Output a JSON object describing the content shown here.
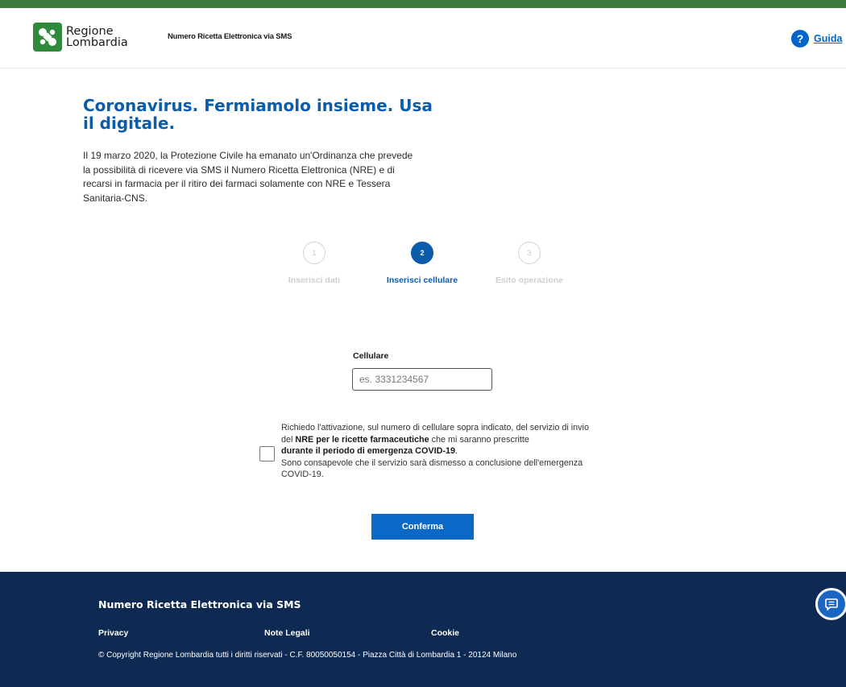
{
  "header": {
    "logo_line1": "Regione",
    "logo_line2": "Lombardia",
    "app_title": "Numero Ricetta Elettronica via SMS",
    "help_icon": "question-icon",
    "help_label": "Guida"
  },
  "main": {
    "heading": "Coronavirus. Fermiamolo insieme. Usa il digitale.",
    "intro": "Il 19 marzo 2020, la Protezione Civile ha emanato un'Ordinanza che prevede la possibilità di ricevere via SMS il Numero Ricetta Elettronica (NRE) e di recarsi in farmacia per il ritiro dei farmaci solamente con NRE e Tessera Sanitaria-CNS."
  },
  "stepper": {
    "steps": [
      {
        "number": "1",
        "label": "Inserisci dati",
        "active": false
      },
      {
        "number": "2",
        "label": "Inserisci cellulare",
        "active": true
      },
      {
        "number": "3",
        "label": "Esito operazione",
        "active": false
      }
    ]
  },
  "form": {
    "phone_label": "Cellulare",
    "phone_placeholder": "es. 3331234567",
    "phone_value": "",
    "consent_checked": false,
    "consent_part1": "Richiedo l'attivazione, sul numero di cellulare sopra indicato, del servizio di invio del ",
    "consent_bold1": "NRE per le ricette farmaceutiche",
    "consent_part2": " che mi saranno prescritte ",
    "consent_bold2": "durante il periodo di emergenza COVID-19",
    "consent_part3": ".",
    "consent_part4": "Sono consapevole che il servizio sarà dismesso a conclusione dell'emergenza COVID-19.",
    "confirm_label": "Conferma"
  },
  "footer": {
    "title": "Numero Ricetta Elettronica via SMS",
    "links": [
      "Privacy",
      "Note Legali",
      "Cookie"
    ],
    "copyright": "© Copyright Regione Lombardia tutti i diritti riservati - C.F. 80050050154 - Piazza Città di Lombardia 1 - 20124 Milano"
  },
  "chat": {
    "icon": "chat-icon"
  },
  "colors": {
    "brand_green": "#3b7a3a",
    "primary_blue": "#0b5cab",
    "footer_navy": "#0e2a52"
  }
}
